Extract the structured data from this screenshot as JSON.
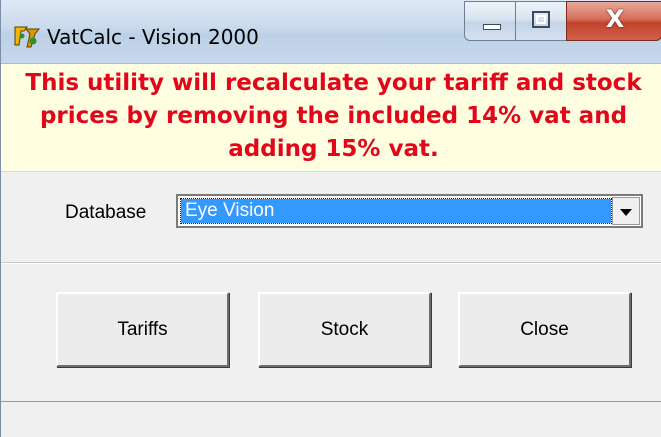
{
  "window": {
    "title": "VatCalc - Vision 2000",
    "close_glyph": "X"
  },
  "banner": {
    "message": "This utility will recalculate your tariff and stock prices by removing the included 14% vat and adding 15% vat.",
    "color": "#e0071b",
    "background": "#fffee0"
  },
  "database": {
    "label": "Database",
    "selected": "Eye Vision"
  },
  "buttons": {
    "tariffs": "Tariffs",
    "stock": "Stock",
    "close": "Close"
  },
  "icons": {
    "app": "app-logo-icon",
    "minimize": "minimize-icon",
    "maximize": "maximize-icon",
    "close": "close-icon",
    "dropdown": "chevron-down-icon"
  }
}
